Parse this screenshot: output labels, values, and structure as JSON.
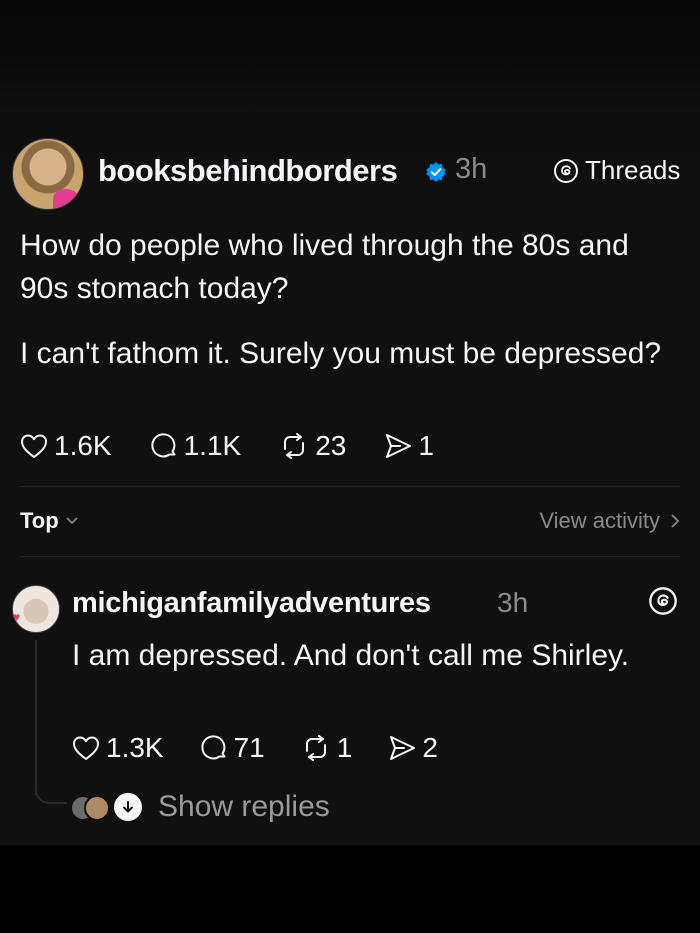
{
  "post": {
    "username": "booksbehindborders",
    "time": "3h",
    "source_label": "Threads",
    "text_paragraph_1": "How do people who lived through the 80s and 90s stomach today?",
    "text_paragraph_2": "I can't fathom it. Surely you must be depressed?",
    "likes": "1.6K",
    "comments": "1.1K",
    "reposts": "23",
    "shares": "1"
  },
  "sort_bar": {
    "sort_label": "Top",
    "view_activity_label": "View activity"
  },
  "reply": {
    "username": "michiganfamilyadventures",
    "time": "3h",
    "text": "I am depressed. And don't call me Shirley.",
    "likes": "1.3K",
    "comments": "71",
    "reposts": "1",
    "shares": "2",
    "show_replies_label": "Show replies"
  },
  "colors": {
    "background": "#101010",
    "text": "#f3f5f7",
    "muted": "#8a8a8a",
    "verified": "#0095f6"
  },
  "icons": [
    "heart-icon",
    "comment-icon",
    "repost-icon",
    "share-icon",
    "threads-logo-icon",
    "verified-badge-icon",
    "chevron-down-icon",
    "chevron-right-icon"
  ]
}
